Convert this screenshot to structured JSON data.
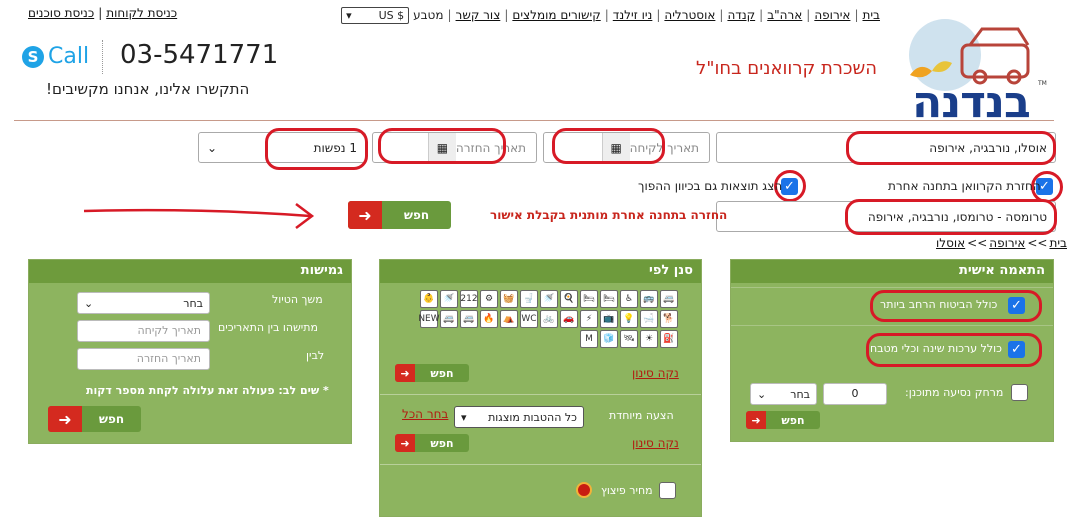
{
  "nav": {
    "links": [
      "בית",
      "אירופה",
      "ארה\"ב",
      "קנדה",
      "אוסטרליה",
      "ניו זילנד",
      "קישורים מומלצים",
      "צור קשר"
    ],
    "currency_label": "מטבע",
    "currency_value": "US $",
    "left_links": [
      "כניסת לקוחות",
      "כניסת סוכנים"
    ]
  },
  "header": {
    "brand_name": "בנדנה",
    "title": "השכרת קרוואנים בחו\"ל",
    "phone": "03-5471771",
    "call_label": "Call",
    "call_note": "התקשרו אלינו, אנחנו מקשיבים!"
  },
  "search": {
    "destination": "אוסלו, נורבגיה, אירופה",
    "pickup_placeholder": "תאריך לקיחה",
    "return_placeholder": "תאריך החזרה",
    "passengers": "1 נפשות",
    "return_other_label": "החזרת הקרוואן בתחנה אחרת",
    "return_other_checked": true,
    "reverse_label": "הצג תוצאות גם בכיוון ההפוך",
    "reverse_checked": true,
    "return_station": "טרומסה - טרומסו, נורבגיה, אירופה",
    "warning": "החזרה בתחנה אחרת מותנית בקבלת אישור",
    "search_button": "חפש"
  },
  "breadcrumb": [
    "בית",
    "אירופה",
    "אוסלו"
  ],
  "panel_personal": {
    "title": "התאמה אישית",
    "opt1_label": "כולל הביטוח הרחב ביותר",
    "opt1_checked": true,
    "opt2_label": "כולל ערכות שינה וכלי מטבח",
    "opt2_checked": true,
    "distance_label": "מרחק נסיעה מתוכנן:",
    "distance_value": "0",
    "distance_unit": "בחר",
    "search_button": "חפש"
  },
  "panel_filter": {
    "title": "סנן לפי",
    "clear_link": "נקה סינון",
    "special_label": "הצעה מיוחדת",
    "special_dropdown": "כל ההטבות מוצגות",
    "select_all_link": "בחר הכל",
    "clear_link2": "נקה סינון",
    "explosive_label": "מחיר פיצוץ",
    "search_button": "חפש",
    "icons": [
      "🚐",
      "🚌",
      "♿",
      "🛏",
      "🛏",
      "🍳",
      "🚿",
      "🚽",
      "🧺",
      "⚙",
      "212",
      "🚿",
      "👶",
      "🐕",
      "🛁",
      "💡",
      "📺",
      "⚡",
      "🚗",
      "🚲",
      "WC",
      "⛺",
      "🔥",
      "🚐",
      "🚐",
      "NEW",
      "⛽",
      "☀",
      "🛰",
      "🧊",
      "M"
    ]
  },
  "panel_flex": {
    "title": "גמישות",
    "trip_length_label": "משך הטיול",
    "trip_length_value": "בחר",
    "between_label": "מתישהו בין התאריכים",
    "from_placeholder": "תאריך לקיחה",
    "to_label": "לבין",
    "to_placeholder": "תאריך החזרה",
    "note": "* שים לב: פעולה זאת עלולה לקחת מספר דקות",
    "search_button": "חפש"
  },
  "colors": {
    "panel_green": "#8db45f",
    "header_green": "#6e9b3c",
    "accent_red": "#d42a1f",
    "title_red": "#c8261d",
    "checkbox_blue": "#1a73e8"
  }
}
